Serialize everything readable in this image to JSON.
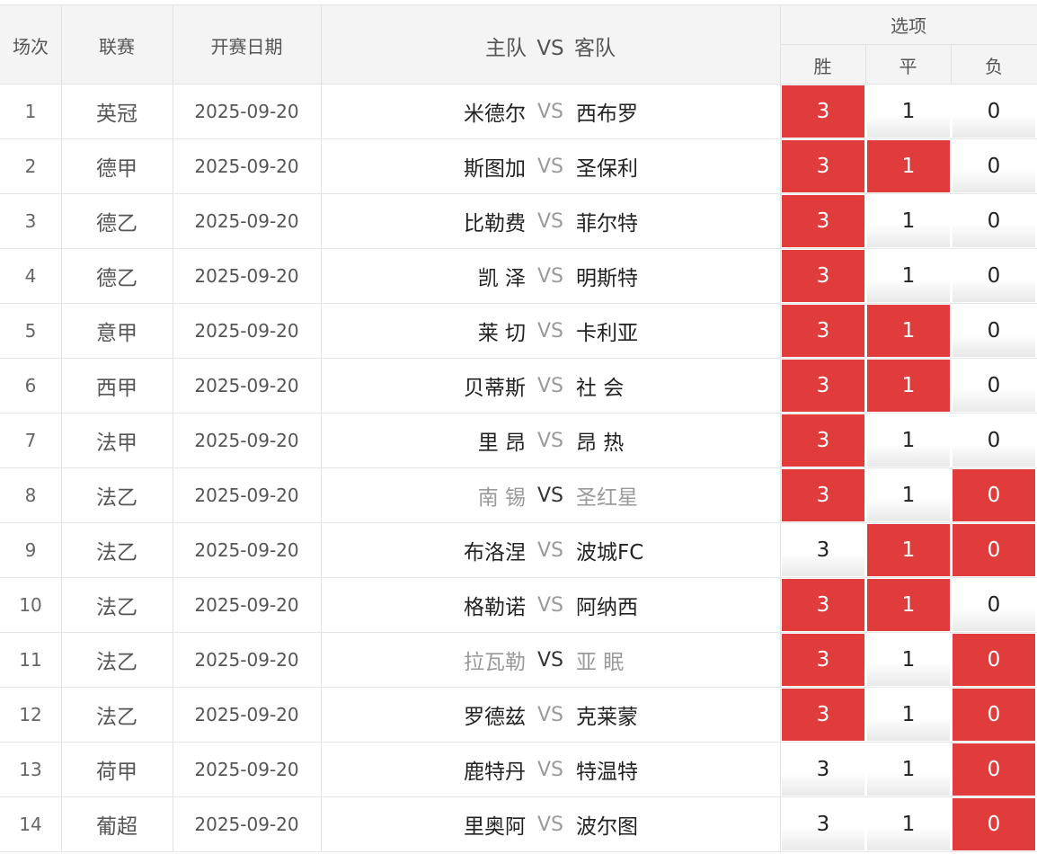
{
  "header": {
    "col_index": "场次",
    "col_league": "联赛",
    "col_date": "开赛日期",
    "col_match": "主队 VS 客队",
    "col_options": "选项",
    "opt_win": "胜",
    "opt_draw": "平",
    "opt_lose": "负"
  },
  "colors": {
    "selected": "#e03c3c",
    "faded_text": "#9a9a9a"
  },
  "rows": [
    {
      "index": "1",
      "league": "英冠",
      "date": "2025-09-20",
      "home": "米德尔",
      "vs": "VS",
      "away": "西布罗",
      "win": "3",
      "draw": "1",
      "lose": "0",
      "sel": [
        true,
        false,
        false
      ],
      "faded": false
    },
    {
      "index": "2",
      "league": "德甲",
      "date": "2025-09-20",
      "home": "斯图加",
      "vs": "VS",
      "away": "圣保利",
      "win": "3",
      "draw": "1",
      "lose": "0",
      "sel": [
        true,
        true,
        false
      ],
      "faded": false
    },
    {
      "index": "3",
      "league": "德乙",
      "date": "2025-09-20",
      "home": "比勒费",
      "vs": "VS",
      "away": "菲尔特",
      "win": "3",
      "draw": "1",
      "lose": "0",
      "sel": [
        true,
        false,
        false
      ],
      "faded": false
    },
    {
      "index": "4",
      "league": "德乙",
      "date": "2025-09-20",
      "home": "凯 泽",
      "vs": "VS",
      "away": "明斯特",
      "win": "3",
      "draw": "1",
      "lose": "0",
      "sel": [
        true,
        false,
        false
      ],
      "faded": false
    },
    {
      "index": "5",
      "league": "意甲",
      "date": "2025-09-20",
      "home": "莱 切",
      "vs": "VS",
      "away": "卡利亚",
      "win": "3",
      "draw": "1",
      "lose": "0",
      "sel": [
        true,
        true,
        false
      ],
      "faded": false
    },
    {
      "index": "6",
      "league": "西甲",
      "date": "2025-09-20",
      "home": "贝蒂斯",
      "vs": "VS",
      "away": "社 会",
      "win": "3",
      "draw": "1",
      "lose": "0",
      "sel": [
        true,
        true,
        false
      ],
      "faded": false
    },
    {
      "index": "7",
      "league": "法甲",
      "date": "2025-09-20",
      "home": "里 昂",
      "vs": "VS",
      "away": "昂 热",
      "win": "3",
      "draw": "1",
      "lose": "0",
      "sel": [
        true,
        false,
        false
      ],
      "faded": false
    },
    {
      "index": "8",
      "league": "法乙",
      "date": "2025-09-20",
      "home": "南 锡",
      "vs": "VS",
      "away": "圣红星",
      "win": "3",
      "draw": "1",
      "lose": "0",
      "sel": [
        true,
        false,
        true
      ],
      "faded": true
    },
    {
      "index": "9",
      "league": "法乙",
      "date": "2025-09-20",
      "home": "布洛涅",
      "vs": "VS",
      "away": "波城FC",
      "win": "3",
      "draw": "1",
      "lose": "0",
      "sel": [
        false,
        true,
        true
      ],
      "faded": false
    },
    {
      "index": "10",
      "league": "法乙",
      "date": "2025-09-20",
      "home": "格勒诺",
      "vs": "VS",
      "away": "阿纳西",
      "win": "3",
      "draw": "1",
      "lose": "0",
      "sel": [
        true,
        true,
        false
      ],
      "faded": false
    },
    {
      "index": "11",
      "league": "法乙",
      "date": "2025-09-20",
      "home": "拉瓦勒",
      "vs": "VS",
      "away": "亚 眠",
      "win": "3",
      "draw": "1",
      "lose": "0",
      "sel": [
        true,
        false,
        true
      ],
      "faded": true
    },
    {
      "index": "12",
      "league": "法乙",
      "date": "2025-09-20",
      "home": "罗德兹",
      "vs": "VS",
      "away": "克莱蒙",
      "win": "3",
      "draw": "1",
      "lose": "0",
      "sel": [
        true,
        false,
        true
      ],
      "faded": false
    },
    {
      "index": "13",
      "league": "荷甲",
      "date": "2025-09-20",
      "home": "鹿特丹",
      "vs": "VS",
      "away": "特温特",
      "win": "3",
      "draw": "1",
      "lose": "0",
      "sel": [
        false,
        false,
        true
      ],
      "faded": false
    },
    {
      "index": "14",
      "league": "葡超",
      "date": "2025-09-20",
      "home": "里奥阿",
      "vs": "VS",
      "away": "波尔图",
      "win": "3",
      "draw": "1",
      "lose": "0",
      "sel": [
        false,
        false,
        true
      ],
      "faded": false
    }
  ]
}
